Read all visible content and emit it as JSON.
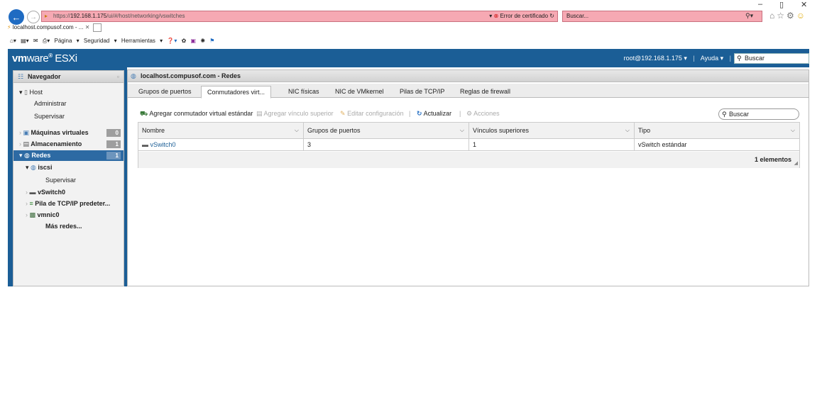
{
  "browser": {
    "address_prefix": "https://",
    "address_host": "192.168.1.175",
    "address_path": "/ui/#/host/networking/vswitches",
    "cert_error": "Error de certificado",
    "search_placeholder": "Buscar...",
    "tab_title": "localhost.compusof.com - ...",
    "menu_page": "Página",
    "menu_security": "Seguridad",
    "menu_tools": "Herramientas"
  },
  "vmware": {
    "logo_vm": "vm",
    "logo_ware": "ware",
    "logo_esxi": "ESXi",
    "user": "root@192.168.1.175",
    "help": "Ayuda",
    "search_placeholder": "Buscar"
  },
  "navigator": {
    "title": "Navegador",
    "items": [
      {
        "label": "Host",
        "level": 0,
        "bold": false
      },
      {
        "label": "Administrar",
        "level": 1,
        "bold": false
      },
      {
        "label": "Supervisar",
        "level": 1,
        "bold": false
      },
      {
        "label": "Máquinas virtuales",
        "level": 0,
        "bold": true,
        "badge": "0"
      },
      {
        "label": "Almacenamiento",
        "level": 0,
        "bold": true,
        "badge": "1"
      },
      {
        "label": "Redes",
        "level": 0,
        "bold": true,
        "badge": "1",
        "selected": true
      },
      {
        "label": "iscsi",
        "level": 1,
        "bold": true
      },
      {
        "label": "Supervisar",
        "level": 2,
        "bold": false
      },
      {
        "label": "vSwitch0",
        "level": 1,
        "bold": true
      },
      {
        "label": "Pila de TCP/IP predeter...",
        "level": 1,
        "bold": true
      },
      {
        "label": "vmnic0",
        "level": 1,
        "bold": true
      },
      {
        "label": "Más redes...",
        "level": 1,
        "bold": true
      }
    ]
  },
  "main": {
    "title": "localhost.compusof.com - Redes",
    "tabs": [
      {
        "label": "Grupos de puertos"
      },
      {
        "label": "Conmutadores virt..."
      },
      {
        "label": "NIC físicas"
      },
      {
        "label": "NIC de VMkernel"
      },
      {
        "label": "Pilas de TCP/IP"
      },
      {
        "label": "Reglas de firewall"
      }
    ],
    "toolbar": {
      "add_switch": "Agregar conmutador virtual estándar",
      "add_uplink": "Agregar vínculo superior",
      "edit": "Editar configuración",
      "refresh": "Actualizar",
      "actions": "Acciones",
      "search_placeholder": "Buscar"
    },
    "table": {
      "columns": [
        "Nombre",
        "Grupos de puertos",
        "Vínculos superiores",
        "Tipo"
      ],
      "rows": [
        {
          "name": "vSwitch0",
          "port_groups": "3",
          "uplinks": "1",
          "type": "vSwitch estándar"
        }
      ],
      "footer": "1 elementos"
    }
  }
}
